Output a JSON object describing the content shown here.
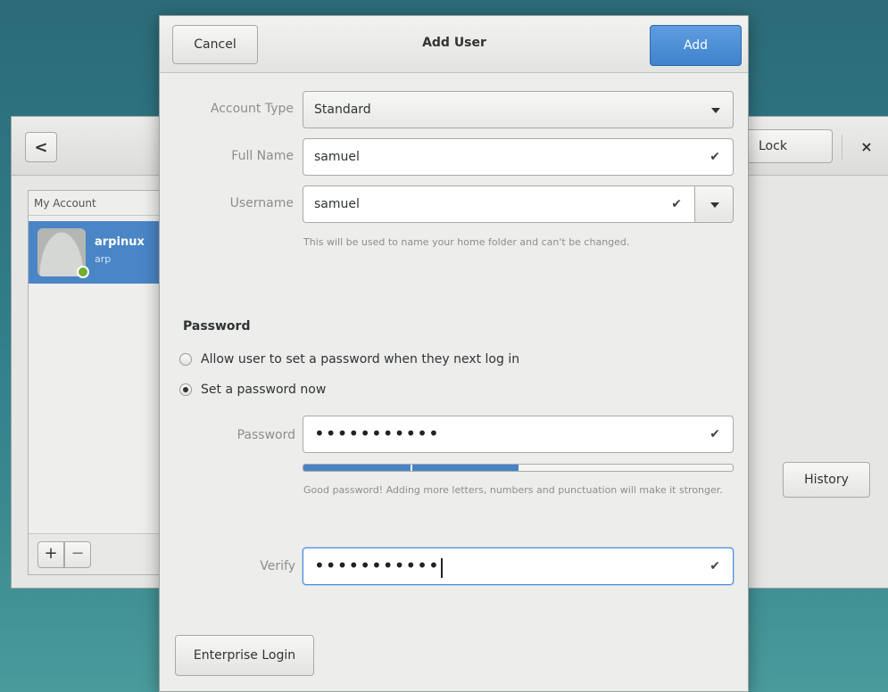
{
  "background_window": {
    "lock_label": "Lock",
    "close_glyph": "×",
    "back_glyph": "<",
    "list_heading": "My Account",
    "user": {
      "name": "arpinux",
      "login": "arp"
    },
    "add_glyph": "+",
    "remove_glyph": "−",
    "history_label": "History"
  },
  "dialog": {
    "title": "Add User",
    "cancel_label": "Cancel",
    "add_label": "Add",
    "account_type": {
      "label": "Account Type",
      "value": "Standard"
    },
    "full_name": {
      "label": "Full Name",
      "value": "samuel"
    },
    "username": {
      "label": "Username",
      "value": "samuel",
      "hint": "This will be used to name your home folder and can't be changed."
    },
    "password_section": {
      "title": "Password",
      "option_next_login": "Allow user to set a password when they next log in",
      "option_now": "Set a password now",
      "selected_option": "now",
      "password": {
        "label": "Password",
        "masked_value": "•••••••••••"
      },
      "strength_fraction": 0.5,
      "strength_hint": "Good password! Adding more letters, numbers and punctuation will make it stronger.",
      "verify": {
        "label": "Verify",
        "masked_value": "•••••••••••"
      }
    },
    "enterprise_login_label": "Enterprise Login",
    "check_glyph": "✔"
  },
  "colors": {
    "accent": "#4a85c6",
    "add_button": "#3f82cc",
    "desktop": "#2f7b86"
  }
}
